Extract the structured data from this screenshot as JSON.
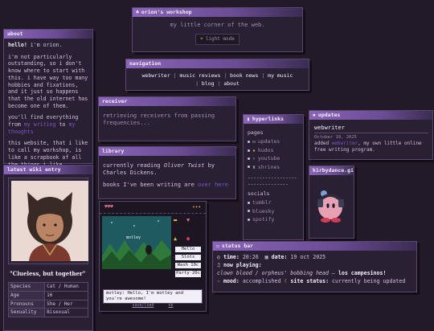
{
  "workshop": {
    "title": "orion's workshop",
    "tagline": "my little corner of the web.",
    "mode_button": "light mode"
  },
  "about": {
    "title": "about",
    "greeting_bold": "hello!",
    "greeting_rest": " i'm orion.",
    "p1": "i'm not particularly outstanding, so i don't know where to start with this. i have way too many hobbies and fixations, and it just so happens that the old internet has become one of them.",
    "p2_start": "you'll find everything from",
    "p2_link1": "my writing",
    "p2_mid": " to ",
    "p2_link2": "my thoughts",
    "p3": "this website, that i like to call my workshop, is like a scrapbook of all the things i like."
  },
  "navigation": {
    "title": "navigation",
    "links": [
      "webwriter",
      "music reviews",
      "book news",
      "my music",
      "blog",
      "about"
    ],
    "sep": "|"
  },
  "receiver": {
    "title": "receiver",
    "text": "retrieving receivers from passing frequencies..."
  },
  "library": {
    "title": "library",
    "line1_pre": "currently reading ",
    "book": "Oliver Twist",
    "line1_post": " by Charles Dickens.",
    "line2_pre": "books I've been writing are ",
    "line2_link": "over here"
  },
  "wiki": {
    "title": "latest wiki entry",
    "quote": "\"Clueless, but together\"",
    "rows": [
      {
        "k": "Species",
        "v": "Cat / Human"
      },
      {
        "k": "Age",
        "v": "16"
      },
      {
        "k": "Pronouns",
        "v": "She / Her"
      },
      {
        "k": "Sexuality",
        "v": "Bisexual"
      }
    ]
  },
  "hyperlinks": {
    "title": "hyperlinks",
    "pages_label": "pages",
    "pages": [
      "updates",
      "kudos",
      "youtube",
      "shrines"
    ],
    "divider": "-------------------------------",
    "socials_label": "socials",
    "socials": [
      "tumblr",
      "bluesky",
      "spotify"
    ]
  },
  "updates": {
    "title": "updates",
    "entry_title": "webwriter",
    "entry_date": "October 19, 2025",
    "entry_pre": "added ",
    "entry_link": "webwriter",
    "entry_post": ", my own little online free writing program."
  },
  "kirby": {
    "title": "kirbydance.gif"
  },
  "game": {
    "hud": [
      "♥♥♥",
      "✦✦✦"
    ],
    "menu": [
      "Hello",
      "Slots",
      "Wash 10c",
      "Party 20c"
    ],
    "dialog": "motley: Hello, I'm motley and you're awesome!",
    "footer": [
      "save/load",
      "ok"
    ],
    "pet_name": "motley"
  },
  "status": {
    "title": "status bar",
    "time_label": "time:",
    "time": "20:26",
    "date_label": "date:",
    "date": "19 oct 2025",
    "np_label": "now playing:",
    "song": "clown blood / orpheus' bobbing head",
    "artist_sep": " – ",
    "artist": "los campesinos!",
    "mood_label": "mood:",
    "mood": "accomplished",
    "site_label": "site status:",
    "site": "currently being updated"
  },
  "colors": {
    "bg": "#221a28",
    "window": "#2a2033",
    "titlebar": "#8a64b8",
    "link": "#7c54c8"
  }
}
